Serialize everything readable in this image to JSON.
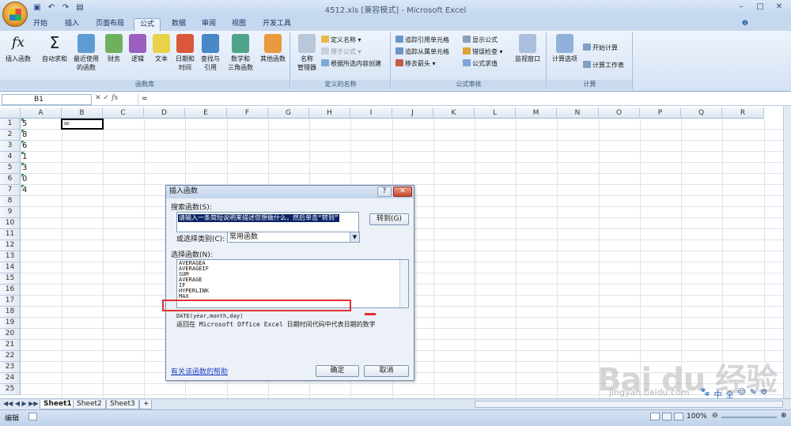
{
  "window": {
    "title": "4512.xls [兼容模式] - Microsoft Excel"
  },
  "qat": {
    "icons": [
      "save-icon",
      "undo-icon",
      "redo-icon",
      "print-preview-icon"
    ]
  },
  "tabs": [
    {
      "label": "开始"
    },
    {
      "label": "插入"
    },
    {
      "label": "页面布局"
    },
    {
      "label": "公式"
    },
    {
      "label": "数据"
    },
    {
      "label": "审阅"
    },
    {
      "label": "视图"
    },
    {
      "label": "开发工具"
    }
  ],
  "ribbon": {
    "library": {
      "label": "函数库",
      "insert_fn": "插入函数",
      "autosum": "自动求和",
      "recent_1": "最近使用",
      "recent_2": "的函数",
      "finance": "财务",
      "logic": "逻辑",
      "text": "文本",
      "datetime_1": "日期和",
      "datetime_2": "时间",
      "lookup_1": "查找与",
      "lookup_2": "引用",
      "math_1": "数学和",
      "math_2": "三角函数",
      "more": "其他函数"
    },
    "names": {
      "label": "定义的名称",
      "manager_1": "名称",
      "manager_2": "管理器",
      "define": "定义名称",
      "use": "用于公式",
      "create": "根据所选内容创建"
    },
    "audit": {
      "label": "公式审核",
      "trace_prec": "追踪引用单元格",
      "trace_dep": "追踪从属单元格",
      "remove": "移去箭头",
      "show": "显示公式",
      "errcheck": "错误检查",
      "evaluate": "公式求值",
      "watch": "监视窗口"
    },
    "calc": {
      "label": "计算",
      "options": "计算选项",
      "calc_now": "开始计算",
      "calc_sheet": "计算工作表"
    }
  },
  "formula_bar": {
    "namebox": "B1",
    "fx": "fx",
    "value": "="
  },
  "columns": [
    "A",
    "B",
    "C",
    "D",
    "E",
    "F",
    "G",
    "H",
    "I",
    "J",
    "K",
    "L",
    "M",
    "N",
    "O",
    "P",
    "Q",
    "R"
  ],
  "rows": [
    "1",
    "2",
    "3",
    "4",
    "5",
    "6",
    "7",
    "8",
    "9",
    "10",
    "11",
    "12",
    "13",
    "14",
    "15",
    "16",
    "17",
    "18",
    "19",
    "20",
    "21",
    "22",
    "23",
    "24",
    "25"
  ],
  "cells_A": [
    "5",
    "8",
    "6",
    "1",
    "3",
    "0",
    "4"
  ],
  "active_cell": {
    "value": "="
  },
  "dialog": {
    "title": "插入函数",
    "search_label": "搜索函数(S):",
    "search_placeholder": "请输入一条简短说明来描述您想做什么，然后单击“转到”",
    "go_button": "转到(G)",
    "category_label": "或选择类别(C):",
    "category_value": "常用函数",
    "list_label": "选择函数(N):",
    "functions": [
      "AVERAGEA",
      "AVERAGEIF",
      "SUM",
      "AVERAGE",
      "IF",
      "HYPERLINK",
      "MAX"
    ],
    "syntax": "DATE(year,month,day)",
    "description": "返回在 Microsoft Office Excel 日期时间代码中代表日期的数字",
    "help_link": "有关该函数的帮助",
    "ok": "确定",
    "cancel": "取消"
  },
  "sheets": [
    "Sheet1",
    "Sheet2",
    "Sheet3"
  ],
  "status": {
    "mode": "编辑",
    "zoom": "100%"
  },
  "watermark": {
    "logo": "Bai du 经验",
    "url": "jingyan.baidu.com"
  },
  "tray": [
    "中",
    "全",
    "☺",
    "✎",
    "⚙"
  ]
}
